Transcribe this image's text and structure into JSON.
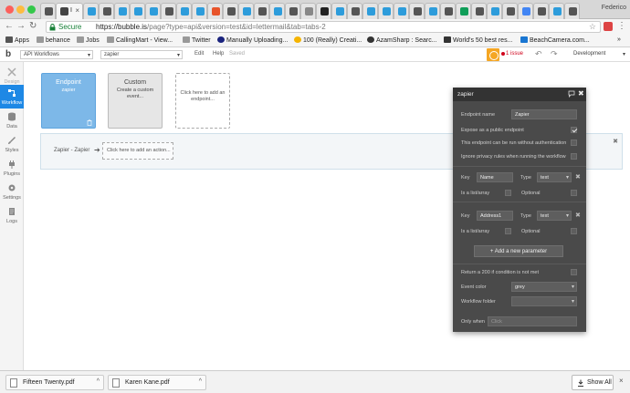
{
  "browser": {
    "active_tab_title": "I",
    "profile_name": "Federico",
    "secure_label": "Secure",
    "url_host": "https://bubble.is",
    "url_path": "/page?type=api&version=test&id=lettermail&tab=tabs-2",
    "bookmarks": [
      {
        "label": "Apps"
      },
      {
        "label": "behance"
      },
      {
        "label": "Jobs"
      },
      {
        "label": "CallingMart - View..."
      },
      {
        "label": "Twitter"
      },
      {
        "label": "Manually Uploading..."
      },
      {
        "label": "100 (Really) Creati..."
      },
      {
        "label": "AzamSharp : Searc..."
      },
      {
        "label": "World's 50 best res..."
      },
      {
        "label": "BeachCamera.com..."
      }
    ]
  },
  "editor": {
    "page_select": "API Workflows",
    "app_select": "zapier",
    "menu": {
      "edit": "Edit",
      "help": "Help",
      "saved": "Saved"
    },
    "issue_text": "1 issue",
    "version_select": "Development"
  },
  "sidebar": {
    "items": [
      {
        "label": "Design"
      },
      {
        "label": "Workflow"
      },
      {
        "label": "Data"
      },
      {
        "label": "Styles"
      },
      {
        "label": "Plugins"
      },
      {
        "label": "Settings"
      },
      {
        "label": "Logs"
      }
    ]
  },
  "canvas": {
    "endpoint_card": {
      "title": "Endpoint",
      "subtitle": "zapier"
    },
    "custom_card": {
      "title": "Custom",
      "subtitle": "Create a custom event..."
    },
    "add_card": {
      "text": "Click here to add an endpoint..."
    },
    "workflow": {
      "name": "Zapier - Zapier",
      "arrow": "➔",
      "add_action": "Click here to add an action..."
    }
  },
  "panel": {
    "title": "zapier",
    "endpoint_name_label": "Endpoint name",
    "endpoint_name_value": "Zapier",
    "expose_label": "Expose as a public endpoint",
    "no_auth_label": "This endpoint can be run without authentication",
    "ignore_privacy_label": "Ignore privacy rules when running the workflow",
    "params": [
      {
        "key_label": "Key",
        "key_value": "Name",
        "type_label": "Type",
        "type_value": "text",
        "list_label": "Is a list/array",
        "optional_label": "Optional"
      },
      {
        "key_label": "Key",
        "key_value": "Address1",
        "type_label": "Type",
        "type_value": "text",
        "list_label": "Is a list/array",
        "optional_label": "Optional"
      }
    ],
    "add_param_label": "Add a new parameter",
    "return_200_label": "Return a 200 if condition is not met",
    "event_color_label": "Event color",
    "event_color_value": "grey",
    "workflow_folder_label": "Workflow folder",
    "only_when_label": "Only when",
    "only_when_placeholder": "Click"
  },
  "downloads": {
    "files": [
      {
        "name": "Fifteen Twenty.pdf"
      },
      {
        "name": "Karen Kane.pdf"
      }
    ],
    "show_all": "Show All"
  },
  "colors": {
    "accent": "#1e88e5",
    "endpoint_card": "#7db8e8",
    "panel_bg": "#4a4a4a",
    "warning": "#f5a623",
    "issue_red": "#d0021b"
  }
}
